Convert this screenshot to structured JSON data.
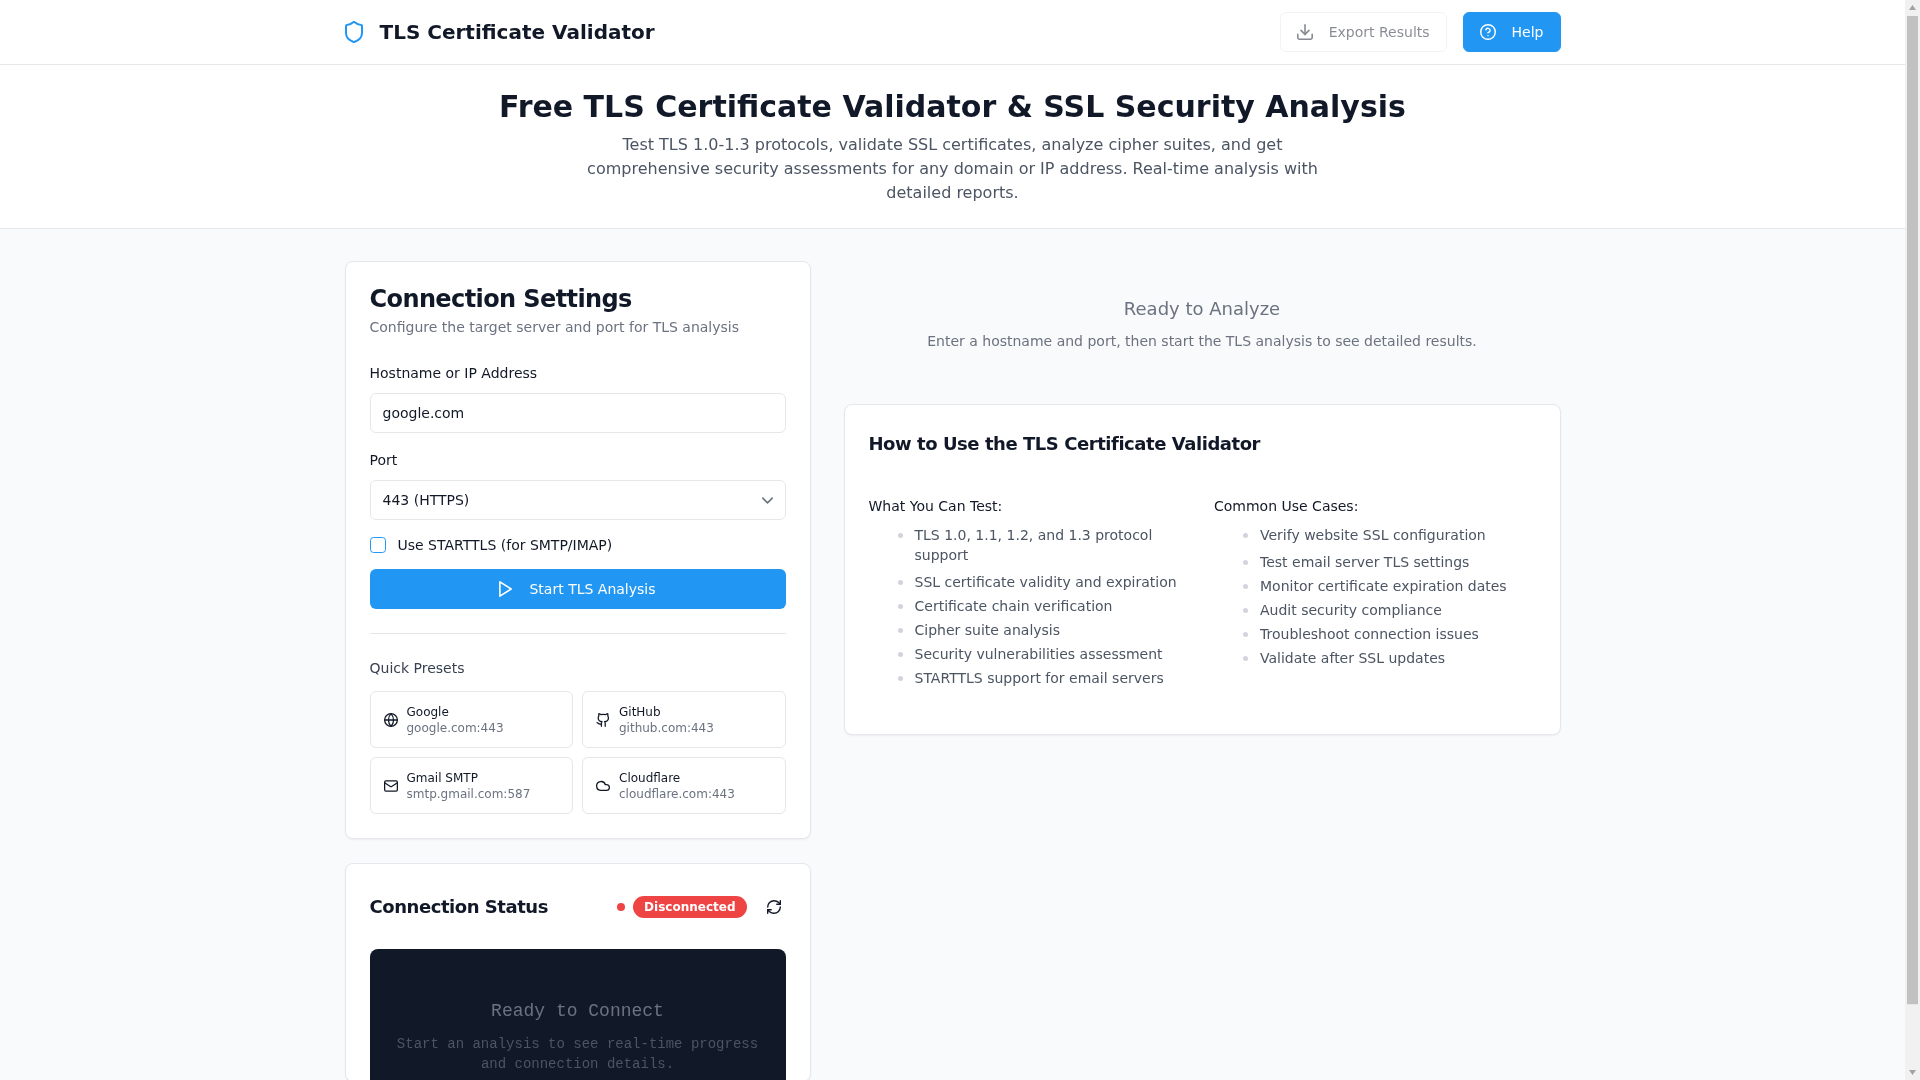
{
  "navbar": {
    "title": "TLS Certificate Validator",
    "buttons": [
      {
        "label": "Export Results",
        "kind": "export",
        "disabled": true
      },
      {
        "label": "Help",
        "kind": "help",
        "disabled": false
      }
    ]
  },
  "hero": {
    "heading": "Free TLS Certificate Validator & SSL Security Analysis",
    "text": "Test TLS 1.0-1.3 protocols, validate SSL certificates, analyze cipher suites, and get comprehensive security assessments for any domain or IP address. Real-time analysis with detailed reports."
  },
  "connection_settings": {
    "title": "Connection Settings",
    "subtitle": "Configure the target server and port for TLS analysis",
    "hostname": {
      "label": "Hostname or IP Address",
      "value": "google.com"
    },
    "port": {
      "label": "Port",
      "value": "443 (HTTPS)"
    },
    "starttls": {
      "label": "Use STARTTLS (for SMTP/IMAP)",
      "checked": false
    },
    "start_button": "Start TLS Analysis",
    "presets_label": "Quick Presets",
    "presets": [
      {
        "name": "Google",
        "host": "google.com:443"
      },
      {
        "name": "GitHub",
        "host": "github.com:443"
      },
      {
        "name": "Gmail SMTP",
        "host": "smtp.gmail.com:587"
      },
      {
        "name": "Cloudflare",
        "host": "cloudflare.com:443"
      }
    ]
  },
  "connection_status": {
    "title": "Connection Status",
    "status": "Disconnected",
    "connected": false,
    "console": {
      "title": "Ready to Connect",
      "text": "Start an analysis to see real-time progress and connection details."
    }
  },
  "results": {
    "title": "Ready to Analyze",
    "text": "Enter a hostname and port, then start the TLS analysis to see detailed results."
  },
  "how_to": {
    "title": "How to Use the TLS Certificate Validator",
    "columns": [
      {
        "heading": "What You Can Test:",
        "items": [
          "TLS 1.0, 1.1, 1.2, and 1.3 protocol support",
          "SSL certificate validity and expiration",
          "Certificate chain verification",
          "Cipher suite analysis",
          "Security vulnerabilities assessment",
          "STARTTLS support for email servers"
        ]
      },
      {
        "heading": "Common Use Cases:",
        "items": [
          "Verify website SSL configuration",
          "Test email server TLS settings",
          "Monitor certificate expiration dates",
          "Audit security compliance",
          "Troubleshoot connection issues",
          "Validate after SSL updates"
        ]
      }
    ]
  }
}
